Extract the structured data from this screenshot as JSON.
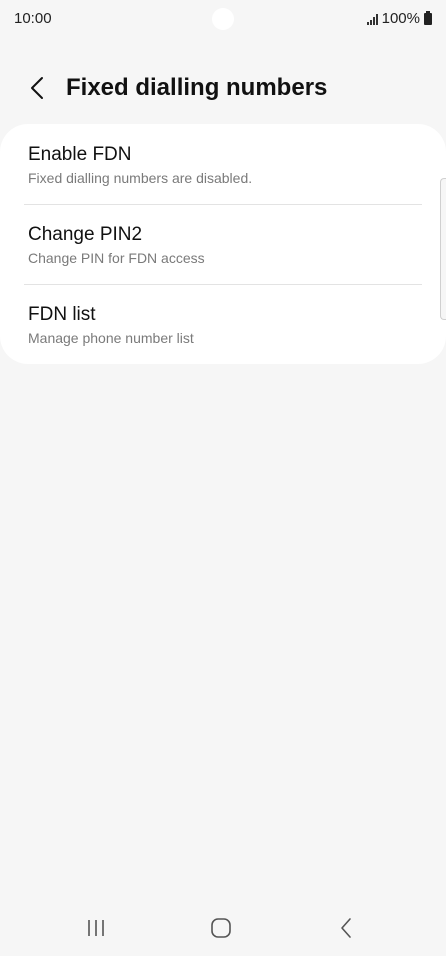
{
  "status_bar": {
    "time": "10:00",
    "battery": "100%"
  },
  "header": {
    "title": "Fixed dialling numbers",
    "back_icon": "chevron-left-icon"
  },
  "settings": [
    {
      "title": "Enable FDN",
      "subtitle": "Fixed dialling numbers are disabled."
    },
    {
      "title": "Change PIN2",
      "subtitle": "Change PIN for FDN access"
    },
    {
      "title": "FDN list",
      "subtitle": "Manage phone number list"
    }
  ],
  "nav_bar": {
    "recents_icon": "recents-icon",
    "home_icon": "home-icon",
    "back_icon": "back-icon"
  },
  "colors": {
    "background": "#f6f6f6",
    "card": "#ffffff",
    "subtitle": "#7a7a7a"
  }
}
